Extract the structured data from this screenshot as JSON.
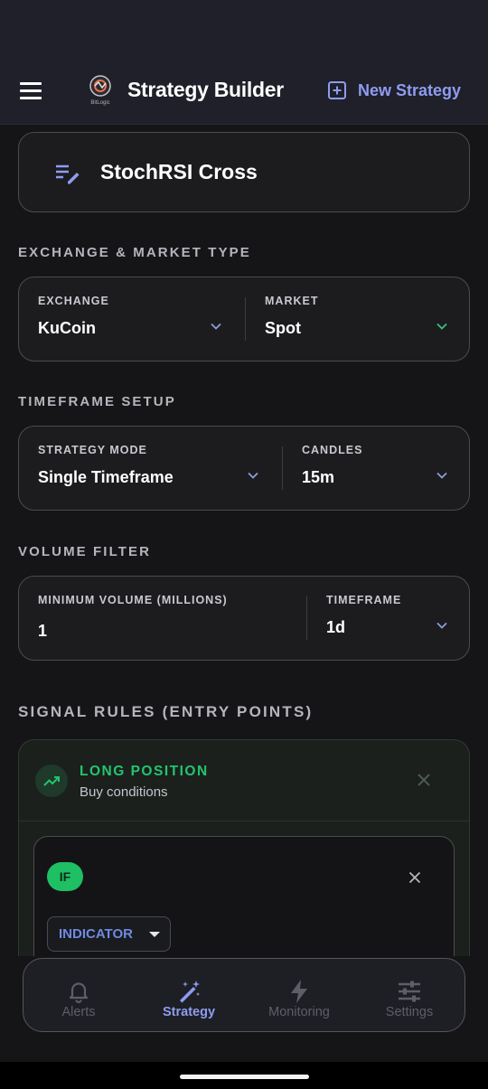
{
  "header": {
    "title": "Strategy Builder",
    "logo_text": "BitLogic",
    "new_strategy_label": "New Strategy"
  },
  "strategy": {
    "name": "StochRSI Cross"
  },
  "exchange_market": {
    "section_title": "EXCHANGE & MARKET TYPE",
    "exchange_label": "EXCHANGE",
    "exchange_value": "KuCoin",
    "market_label": "MARKET",
    "market_value": "Spot"
  },
  "timeframe_setup": {
    "section_title": "TIMEFRAME SETUP",
    "mode_label": "STRATEGY MODE",
    "mode_value": "Single Timeframe",
    "candles_label": "CANDLES",
    "candles_value": "15m"
  },
  "volume_filter": {
    "section_title": "VOLUME FILTER",
    "min_volume_label": "MINIMUM VOLUME (MILLIONS)",
    "min_volume_value": "1",
    "timeframe_label": "TIMEFRAME",
    "timeframe_value": "1d"
  },
  "signal_rules": {
    "section_title": "SIGNAL RULES (ENTRY POINTS)",
    "long": {
      "title": "LONG POSITION",
      "subtitle": "Buy conditions"
    },
    "rule": {
      "if_label": "IF",
      "indicator_label": "INDICATOR"
    }
  },
  "bottom_nav": {
    "items": [
      {
        "label": "Alerts",
        "icon": "bell-icon",
        "active": false
      },
      {
        "label": "Strategy",
        "icon": "magic-wand-icon",
        "active": true
      },
      {
        "label": "Monitoring",
        "icon": "lightning-icon",
        "active": false
      },
      {
        "label": "Settings",
        "icon": "sliders-icon",
        "active": false
      }
    ]
  },
  "colors": {
    "background": "#151517",
    "header": "#1f2029",
    "accent": "#8f9cf1",
    "long_green": "#22c56e",
    "if_badge": "#1fbf64",
    "indicator_blue": "#6f8ae0",
    "chevron_blue": "#8a9fd8",
    "chevron_green": "#3fbf7f"
  }
}
